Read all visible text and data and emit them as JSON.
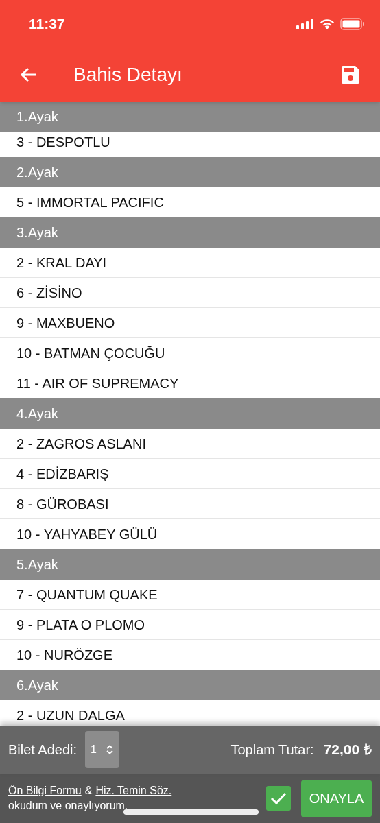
{
  "status_bar": {
    "time": "11:37"
  },
  "app_bar": {
    "title": "Bahis Detayı"
  },
  "legs": [
    {
      "title": "1.Ayak",
      "horses": [
        "3 - DESPOTLU"
      ]
    },
    {
      "title": "2.Ayak",
      "horses": [
        "5 - IMMORTAL PACIFIC"
      ]
    },
    {
      "title": "3.Ayak",
      "horses": [
        "2 - KRAL DAYI",
        "6 - ZİSİNO",
        "9 - MAXBUENO",
        "10 - BATMAN ÇOCUĞU",
        "11 - AIR OF SUPREMACY"
      ]
    },
    {
      "title": "4.Ayak",
      "horses": [
        "2 - ZAGROS ASLANI",
        "4 - EDİZBARIŞ",
        "8 - GÜROBASI",
        "10 - YAHYABEY GÜLÜ"
      ]
    },
    {
      "title": "5.Ayak",
      "horses": [
        "7 - QUANTUM QUAKE",
        "9 - PLATA O PLOMO",
        "10 - NURÖZGE"
      ]
    },
    {
      "title": "6.Ayak",
      "horses": [
        "2 - UZUN DALGA"
      ]
    }
  ],
  "footer": {
    "ticket_count_label": "Bilet Adedi:",
    "ticket_count": "1",
    "total_label": "Toplam Tutar:",
    "total_value": "72,00 ₺",
    "agreement": {
      "link_1": "Ön Bilgi Formu",
      "joiner": "&",
      "link_2": "Hiz. Temin Söz.",
      "text": "okudum ve onaylıyorum.",
      "checked": true
    },
    "confirm_button": "ONAYLA"
  }
}
